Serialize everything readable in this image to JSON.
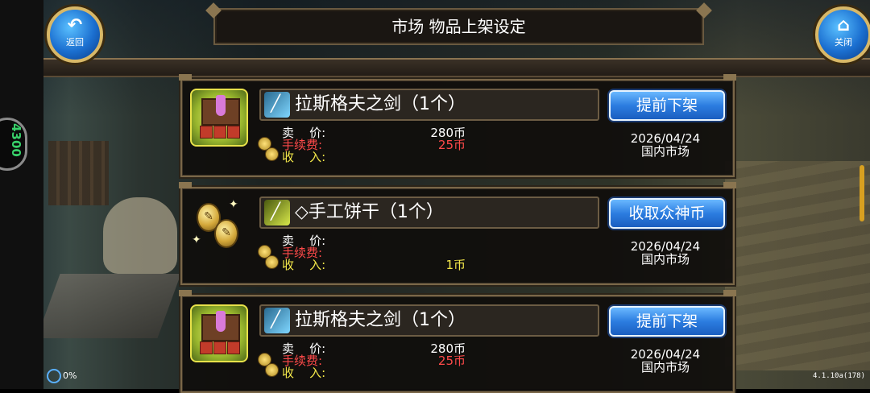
{
  "header": {
    "title": "市场 物品上架设定",
    "back_label": "返回",
    "close_label": "关闭"
  },
  "status": {
    "side_badge": "4300",
    "loading_percent": "0%",
    "version": "4.1.10a(178)"
  },
  "listings": [
    {
      "icon": "goods-stand-icon",
      "name": "拉斯格夫之剑（1个）",
      "action": "提前下架",
      "sell_label": "卖    价:",
      "fee_label": "手续费:",
      "income_label": "收    入:",
      "price": "280币",
      "fee": "25币",
      "income": "",
      "date": "2026/04/24",
      "market": "国内市场"
    },
    {
      "icon": "coins-icon",
      "name": "◇手工饼干（1个）",
      "action": "收取众神币",
      "sell_label": "卖    价:",
      "fee_label": "手续费:",
      "income_label": "收    入:",
      "price": "",
      "fee": "",
      "income": "1币",
      "date": "2026/04/24",
      "market": "国内市场"
    },
    {
      "icon": "goods-stand-icon",
      "name": "拉斯格夫之剑（1个）",
      "action": "提前下架",
      "sell_label": "卖    价:",
      "fee_label": "手续费:",
      "income_label": "收    入:",
      "price": "280币",
      "fee": "25币",
      "income": "",
      "date": "2026/04/24",
      "market": "国内市场"
    }
  ],
  "colors": {
    "fee_red": "#ff4a4a",
    "income_yellow": "#f4e84a",
    "button_blue": "#2c7de0",
    "frame_gold": "#d8b868"
  }
}
